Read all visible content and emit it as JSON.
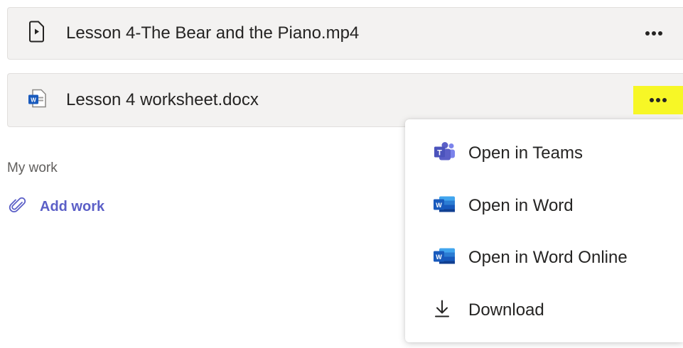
{
  "files": [
    {
      "name": "Lesson 4-The Bear and the Piano.mp4",
      "icon": "video-file-icon"
    },
    {
      "name": "Lesson 4 worksheet.docx",
      "icon": "word-file-icon"
    }
  ],
  "my_work": {
    "label": "My work",
    "add_work_label": "Add work"
  },
  "context_menu": {
    "items": [
      {
        "label": "Open in Teams",
        "icon": "teams-icon"
      },
      {
        "label": "Open in Word",
        "icon": "word-icon"
      },
      {
        "label": "Open in Word Online",
        "icon": "word-icon"
      },
      {
        "label": "Download",
        "icon": "download-icon"
      }
    ]
  },
  "colors": {
    "accent": "#5b5fc7",
    "highlight": "#f7f726",
    "word_blue": "#185abd",
    "teams_purple": "#5b5fc7"
  }
}
